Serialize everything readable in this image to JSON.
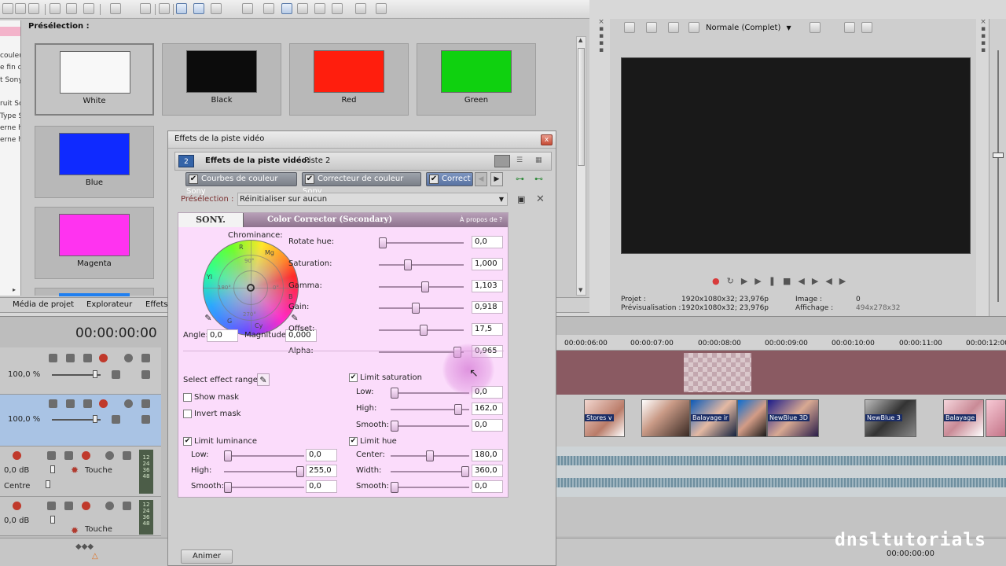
{
  "top_toolbar": {
    "icons": [
      "new-icon",
      "open-icon",
      "save-icon",
      "cut-icon",
      "copy-icon",
      "paste-icon",
      "undo-icon",
      "redo-icon",
      "render-icon",
      "properties-icon",
      "select-icon",
      "normal-edit-icon",
      "envelope-icon",
      "selection-icon",
      "zoom-icon",
      "trim-icon",
      "help-icon"
    ]
  },
  "presets": {
    "label": "Présélection :",
    "items": [
      {
        "name": "White",
        "color": "#f8f8f8"
      },
      {
        "name": "Black",
        "color": "#0c0c0c"
      },
      {
        "name": "Red",
        "color": "#ff1e0d"
      },
      {
        "name": "Green",
        "color": "#0fd10f"
      },
      {
        "name": "Blue",
        "color": "#0f2aff"
      },
      {
        "name": "Magenta",
        "color": "#ff33f0"
      }
    ],
    "left_list": [
      "couleu",
      "e fin d",
      "t Sony",
      "ruit Sc",
      "Type S",
      "erne h",
      "erne h"
    ]
  },
  "bottom_tabs": [
    "Média de projet",
    "Explorateur",
    "Effets"
  ],
  "timecode": "00:00:00:00",
  "tracks": {
    "video1_level": "100,0 %",
    "video2_level": "100,0 %",
    "audio1_db": "0,0 dB",
    "audio1_mode": "Touche",
    "audio1_pan": "Centre",
    "audio2_db": "0,0 dB",
    "audio2_mode": "Touche",
    "meter_labels": [
      "12",
      "24",
      "36",
      "48"
    ]
  },
  "preview": {
    "quality": "Normale (Complet)",
    "info": {
      "projet_label": "Projet :",
      "projet_value": "1920x1080x32; 23,976p",
      "previs_label": "Prévisualisation :",
      "previs_value": "1920x1080x32; 23,976p",
      "image_label": "Image :",
      "image_value": "0",
      "affichage_label": "Affichage :",
      "affichage_value": "494x278x32"
    }
  },
  "timeline": {
    "ruler": [
      "00:00:06:00",
      "00:00:07:00",
      "00:00:08:00",
      "00:00:09:00",
      "00:00:10:00",
      "00:00:11:00",
      "00:00:12:00"
    ],
    "clips": [
      "Stores v",
      "Balayage ir",
      "NewBlue 3D",
      "NewBlue 3",
      "Balayage"
    ],
    "bottom_timecode": "00:00:00:00"
  },
  "watermark": "dnsltutorials",
  "dialog": {
    "title": "Effets de la piste vidéo",
    "close": "x",
    "badge": "2",
    "header_label": "Effets de la piste vidéo:",
    "header_value": "Piste 2",
    "chain_tabs": [
      "Courbes de couleur Sony",
      "Correcteur de couleur Sony",
      "Correct"
    ],
    "preset_label": "Présélection :",
    "preset_value": "Réinitialiser sur aucun",
    "sony": "SONY.",
    "plugin_name": "Color Corrector (Secondary)",
    "about": "À propos de",
    "about_q": "?",
    "animate": "Animer",
    "wheel": {
      "label": "Chrominance:",
      "letters": [
        "R",
        "Mg",
        "B",
        "Cy",
        "G",
        "Yl"
      ],
      "degrees": [
        "90°",
        "180°",
        "0°",
        "270°"
      ],
      "angle_label": "Angle:",
      "angle_value": "0,0",
      "magnitude_label": "Magnitude:",
      "magnitude_value": "0,000"
    },
    "params": [
      {
        "label": "Rotate hue:",
        "value": "0,0",
        "pos": 0.0
      },
      {
        "label": "Saturation:",
        "value": "1,000",
        "pos": 0.33
      },
      {
        "label": "Gamma:",
        "value": "1,103",
        "pos": 0.55
      },
      {
        "label": "Gain:",
        "value": "0,918",
        "pos": 0.43
      },
      {
        "label": "Offset:",
        "value": "17,5",
        "pos": 0.53
      },
      {
        "label": "Alpha:",
        "value": "0,965",
        "pos": 0.97
      }
    ],
    "effect_range_label": "Select effect range:",
    "show_mask": "Show mask",
    "invert_mask": "Invert mask",
    "limit_luminance": {
      "label": "Limit luminance",
      "checked": true,
      "rows": [
        {
          "label": "Low:",
          "value": "0,0",
          "pos": 0.0
        },
        {
          "label": "High:",
          "value": "255,0",
          "pos": 1.0
        },
        {
          "label": "Smooth:",
          "value": "0,0",
          "pos": 0.0
        }
      ]
    },
    "limit_saturation": {
      "label": "Limit saturation",
      "checked": true,
      "rows": [
        {
          "label": "Low:",
          "value": "0,0",
          "pos": 0.0
        },
        {
          "label": "High:",
          "value": "162,0",
          "pos": 0.9
        },
        {
          "label": "Smooth:",
          "value": "0,0",
          "pos": 0.0
        }
      ]
    },
    "limit_hue": {
      "label": "Limit hue",
      "checked": true,
      "rows": [
        {
          "label": "Center:",
          "value": "180,0",
          "pos": 0.5
        },
        {
          "label": "Width:",
          "value": "360,0",
          "pos": 1.0
        },
        {
          "label": "Smooth:",
          "value": "0,0",
          "pos": 0.0
        }
      ]
    }
  }
}
